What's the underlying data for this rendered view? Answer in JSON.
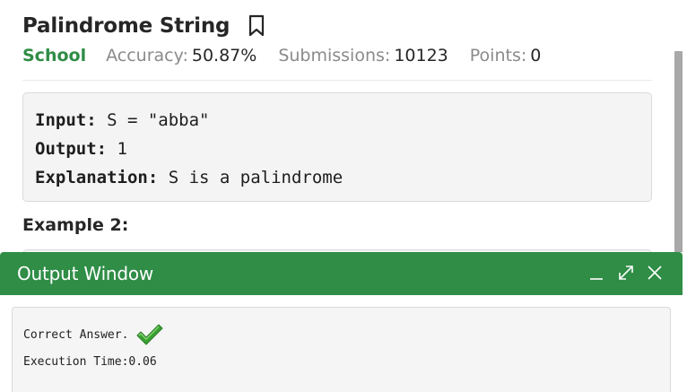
{
  "problem": {
    "title": "Palindrome String",
    "difficulty": "School",
    "accuracy_label": "Accuracy:",
    "accuracy_value": "50.87%",
    "submissions_label": "Submissions:",
    "submissions_value": "10123",
    "points_label": "Points:",
    "points_value": "0"
  },
  "example1": {
    "input_label": "Input:",
    "input_value": " S = \"abba\"",
    "output_label": "Output:",
    "output_value": " 1",
    "explanation_label": "Explanation:",
    "explanation_value": " S is a palindrome"
  },
  "example2": {
    "heading": "Example 2:"
  },
  "output_window": {
    "title": "Output Window",
    "result": "Correct Answer.",
    "execution_time": "Execution Time:0.06"
  },
  "icons": {
    "bookmark": "bookmark-icon",
    "minimize": "minimize-icon",
    "expand": "expand-icon",
    "close": "close-icon",
    "check": "checkmark-icon"
  },
  "colors": {
    "brand_green": "#2f8d46",
    "check_green": "#3aa233"
  }
}
